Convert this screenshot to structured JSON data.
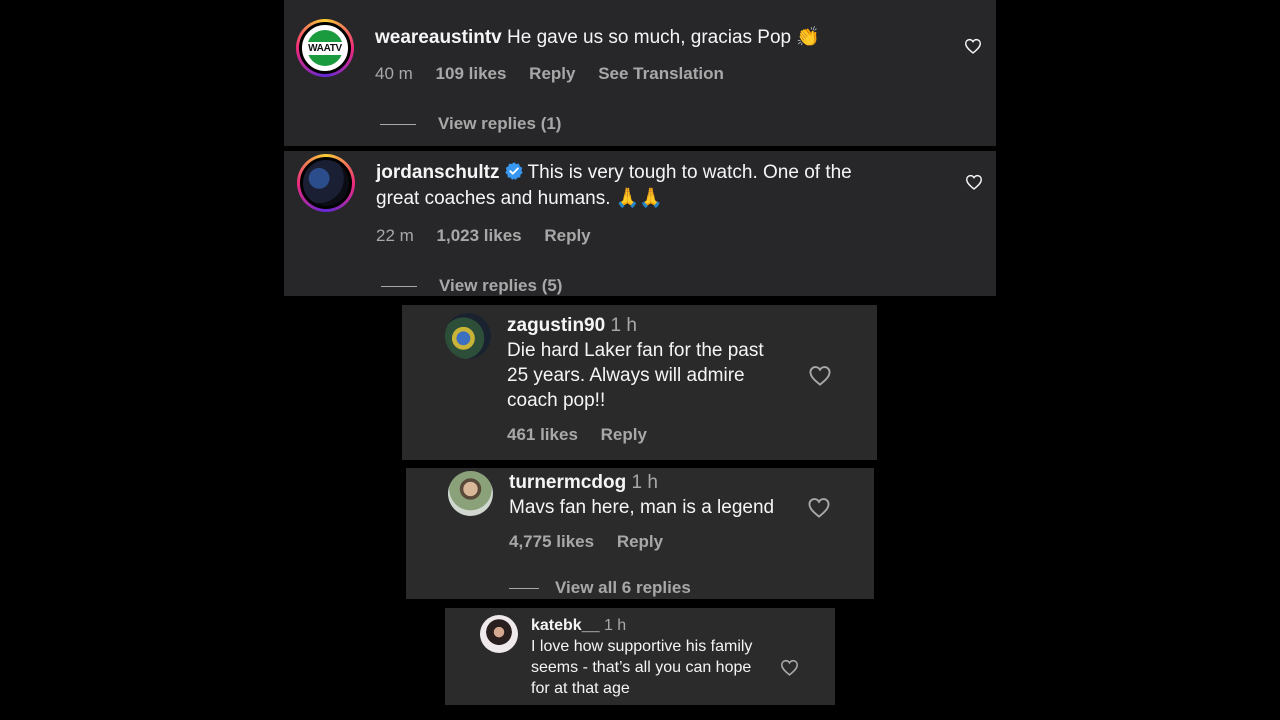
{
  "comments": [
    {
      "username": "weareaustintv",
      "avatar_text": "WAATV",
      "text": "He gave us so much, gracias Pop 👏",
      "time": "40 m",
      "likes": "109 likes",
      "reply": "Reply",
      "translate": "See Translation",
      "view_replies": "View replies (1)"
    },
    {
      "username": "jordanschultz",
      "verified": true,
      "text_line1": "This is very tough to watch. One of the",
      "text_line2": "great coaches and humans. 🙏🙏",
      "time": "22 m",
      "likes": "1,023 likes",
      "reply": "Reply",
      "view_replies": "View replies (5)"
    },
    {
      "username": "zagustin90",
      "time": "1 h",
      "text_lines": [
        "Die hard Laker fan for the past",
        "25 years. Always will admire",
        "coach pop!!"
      ],
      "likes": "461 likes",
      "reply": "Reply"
    },
    {
      "username": "turnermcdog",
      "time": "1 h",
      "text": "Mavs fan here, man is a legend",
      "likes": "4,775 likes",
      "reply": "Reply",
      "view_replies": "View all 6 replies"
    },
    {
      "username": "katebk__",
      "time": "1 h",
      "text_lines": [
        "I love how supportive his family",
        "seems - that’s all you can hope",
        "for at that age"
      ]
    }
  ],
  "icons": {
    "like": "heart-outline-icon",
    "verified": "verified-badge-icon"
  },
  "colors": {
    "background": "#000000",
    "card": "#27272a",
    "text": "#f5f5f5",
    "muted": "#a8a8a8",
    "verified": "#3897f0"
  }
}
